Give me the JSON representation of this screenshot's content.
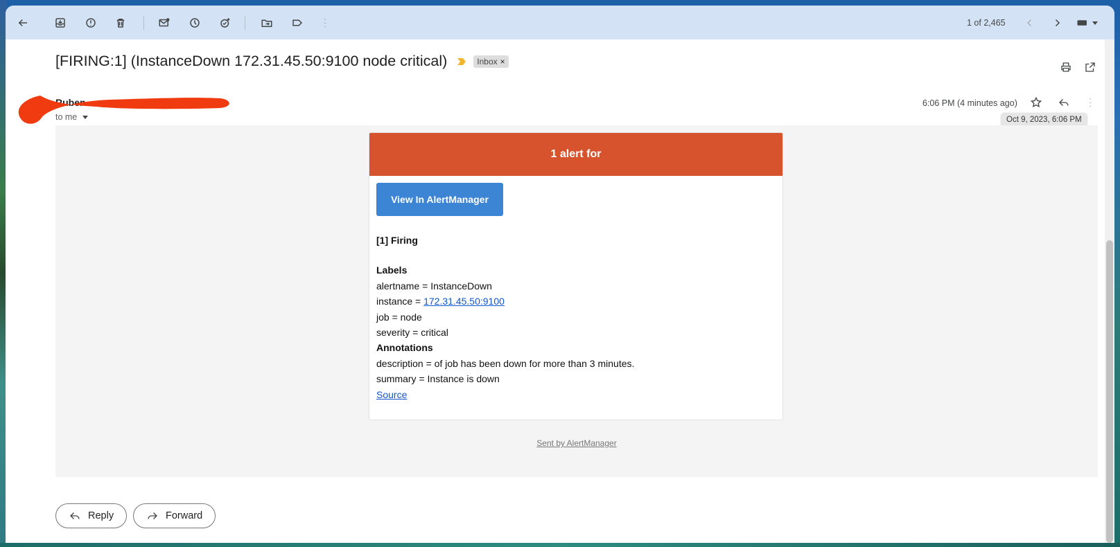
{
  "toolbar": {
    "back_icon": "arrow-left-icon",
    "archive_icon": "archive-icon",
    "spam_icon": "report-spam-icon",
    "delete_icon": "trash-icon",
    "mark_unread_icon": "mark-unread-icon",
    "snooze_icon": "clock-icon",
    "add_task_icon": "add-task-icon",
    "move_icon": "move-to-folder-icon",
    "label_icon": "label-icon",
    "more_icon": "more-vert-icon",
    "pager_text": "1 of 2,465",
    "prev_icon": "chevron-left-icon",
    "next_icon": "chevron-right-icon",
    "keyboard_icon": "keyboard-icon"
  },
  "message": {
    "subject": "[FIRING:1] (InstanceDown 172.31.45.50:9100 node critical)",
    "label_chip": "Inbox",
    "label_chip_close": "×",
    "sender_name": "Ruben",
    "recipient": "to me",
    "time": "6:06 PM (4 minutes ago)",
    "tooltip": "Oct 9, 2023, 6:06 PM"
  },
  "email": {
    "header": "1 alert for",
    "button": "View In AlertManager",
    "firing": "[1] Firing",
    "labels_heading": "Labels",
    "alertname": "alertname = InstanceDown",
    "instance_prefix": "instance = ",
    "instance_link": "172.31.45.50:9100",
    "job": "job = node",
    "severity": "severity = critical",
    "annotations_heading": "Annotations",
    "description": "description = of job has been down for more than 3 minutes.",
    "summary": "summary = Instance is down",
    "source_link": "Source",
    "sent_by": "Sent by AlertManager"
  },
  "actions": {
    "reply": "Reply",
    "forward": "Forward"
  },
  "colors": {
    "alert_header": "#d6532d",
    "button_blue": "#3c84d4",
    "toolbar_bg": "#d3e3f5",
    "body_bg": "#f4f4f4",
    "redaction": "#f03a10"
  }
}
